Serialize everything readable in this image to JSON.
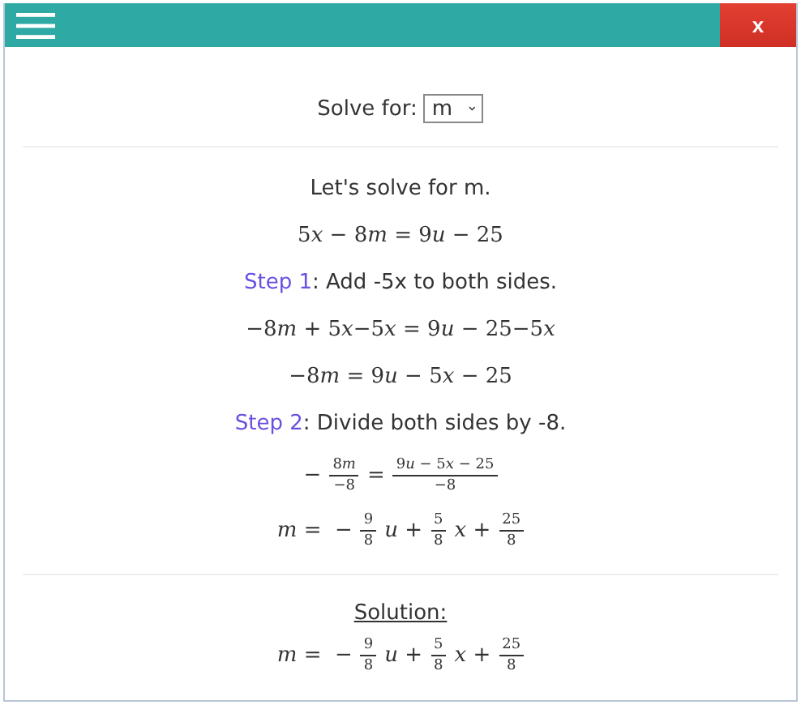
{
  "header": {
    "close": "x"
  },
  "solve_for": {
    "label": "Solve for:",
    "value": "m"
  },
  "steps": [
    {
      "kind": "sentence",
      "text": "Let's solve for m."
    },
    {
      "kind": "equation",
      "parts": [
        {
          "kind": "text",
          "text": "5x − 8m = 9u − 25"
        }
      ]
    },
    {
      "kind": "step",
      "label": "Step 1",
      "text": ": Add -5x to both sides."
    },
    {
      "kind": "equation",
      "parts": [
        {
          "kind": "text",
          "text": "−8m + 5x−5x = 9u − 25−5x"
        }
      ]
    },
    {
      "kind": "equation",
      "parts": [
        {
          "kind": "text",
          "text": "−8m = 9u − 5x − 25"
        }
      ]
    },
    {
      "kind": "step",
      "label": "Step 2",
      "text": ": Divide both sides by -8."
    },
    {
      "kind": "equation",
      "parts": [
        {
          "kind": "text",
          "text": "−"
        },
        {
          "kind": "frac",
          "num": "8m",
          "den": "−8"
        },
        {
          "kind": "text",
          "text": "="
        },
        {
          "kind": "frac",
          "num": "9u − 5x − 25",
          "den": "−8"
        }
      ]
    },
    {
      "kind": "equation",
      "parts": [
        {
          "kind": "text",
          "text": "m =  −"
        },
        {
          "kind": "frac",
          "num": "9",
          "den": "8"
        },
        {
          "kind": "text",
          "text": "u +"
        },
        {
          "kind": "frac",
          "num": "5",
          "den": "8"
        },
        {
          "kind": "text",
          "text": "x +"
        },
        {
          "kind": "frac",
          "num": "25",
          "den": "8"
        }
      ]
    }
  ],
  "solution": {
    "title": "Solution:",
    "parts": [
      {
        "kind": "text",
        "text": "m =  −"
      },
      {
        "kind": "frac",
        "num": "9",
        "den": "8"
      },
      {
        "kind": "text",
        "text": "u +"
      },
      {
        "kind": "frac",
        "num": "5",
        "den": "8"
      },
      {
        "kind": "text",
        "text": "x +"
      },
      {
        "kind": "frac",
        "num": "25",
        "den": "8"
      }
    ]
  }
}
